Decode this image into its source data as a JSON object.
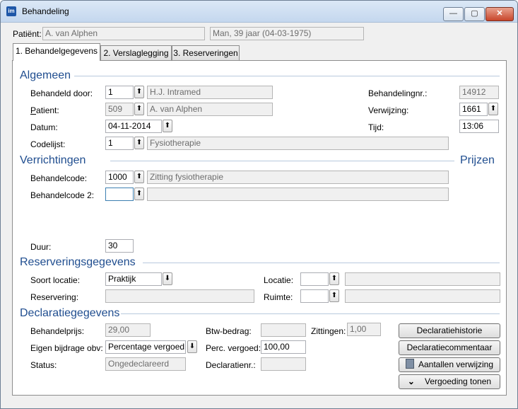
{
  "window": {
    "title": "Behandeling",
    "minimize_glyph": "—",
    "maximize_glyph": "▢",
    "close_glyph": "✕",
    "app_icon_text": "im"
  },
  "patient_bar": {
    "label": "Patiënt:",
    "name": "A. van Alphen",
    "info": "Man, 39 jaar (04-03-1975)"
  },
  "tabs": [
    {
      "label": "1. Behandelgegevens"
    },
    {
      "label": "2. Verslaglegging"
    },
    {
      "label": "3. Reserveringen"
    }
  ],
  "sections": {
    "algemeen": "Algemeen",
    "verrichtingen": "Verrichtingen",
    "prijzen": "Prijzen",
    "reservering": "Reserveringsgegevens",
    "declaratie": "Declaratiegegevens"
  },
  "algemeen": {
    "behandeld_door_label": "Behandeld door:",
    "behandeld_door_code": "1",
    "behandeld_door_name": "H.J. Intramed",
    "patient_label": "Patient:",
    "patient_code": "509",
    "patient_name": "A. van Alphen",
    "datum_label": "Datum:",
    "datum_value": "04-11-2014",
    "codelijst_label": "Codelijst:",
    "codelijst_code": "1",
    "codelijst_name": "Fysiotherapie",
    "behandelingnr_label": "Behandelingnr.:",
    "behandelingnr_value": "14912",
    "verwijzing_label": "Verwijzing:",
    "verwijzing_value": "1661",
    "tijd_label": "Tijd:",
    "tijd_value": "13:06"
  },
  "verrichtingen": {
    "behandelcode_label": "Behandelcode:",
    "behandelcode_value": "1000",
    "behandelcode_desc": "Zitting fysiotherapie",
    "behandelcode2_label": "Behandelcode 2:",
    "behandelcode2_value": "",
    "behandelcode2_desc": "",
    "duur_label": "Duur:",
    "duur_value": "30"
  },
  "reservering": {
    "soort_locatie_label": "Soort locatie:",
    "soort_locatie_value": "Praktijk",
    "reservering_label": "Reservering:",
    "reservering_value": "",
    "locatie_label": "Locatie:",
    "locatie_code": "",
    "locatie_name": "",
    "ruimte_label": "Ruimte:",
    "ruimte_code": "",
    "ruimte_name": ""
  },
  "declaratie": {
    "behandelprijs_label": "Behandelprijs:",
    "behandelprijs_value": "29,00",
    "eigen_bijdrage_label": "Eigen bijdrage obv:",
    "eigen_bijdrage_value": "Percentage vergoed",
    "status_label": "Status:",
    "status_value": "Ongedeclareerd",
    "btw_label": "Btw-bedrag:",
    "btw_value": "",
    "perc_label": "Perc. vergoed:",
    "perc_value": "100,00",
    "declaratienr_label": "Declaratienr.:",
    "declaratienr_value": "",
    "zittingen_label": "Zittingen:",
    "zittingen_value": "1,00"
  },
  "buttons": {
    "declaratiehistorie": "Declaratiehistorie",
    "declaratiecommentaar": "Declaratiecommentaar",
    "aantallen_verwijzing": "Aantallen verwijzing",
    "vergoeding_tonen": "Vergoeding tonen"
  },
  "glyphs": {
    "lookup": "⬆",
    "dropdown": "⬇",
    "chevron": "⌄"
  },
  "colors": {
    "section_heading": "#1f4d8f",
    "section_line": "#b8c9dd",
    "titlebar": "#c4d7ee",
    "close_button": "#c8452b"
  }
}
